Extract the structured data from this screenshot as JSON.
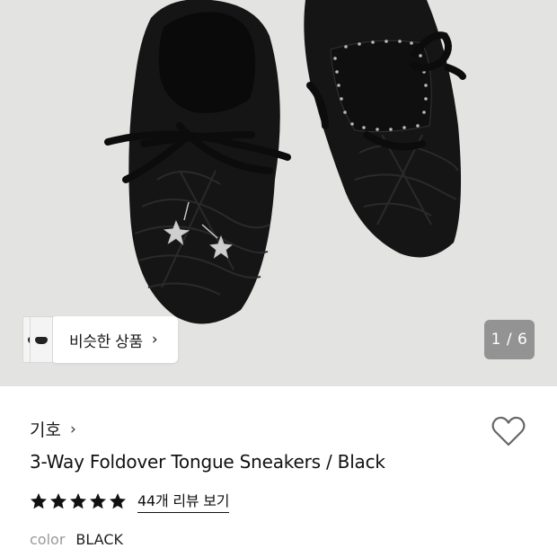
{
  "gallery": {
    "counter": "1 / 6",
    "similar_products_label": "비슷한 상품",
    "similar_chevron": "›"
  },
  "product": {
    "brand": "기호",
    "brand_chevron": "›",
    "title": "3-Way Foldover Tongue Sneakers / Black",
    "rating_stars": 5,
    "review_link": "44개 리뷰 보기",
    "color_label": "color",
    "color_value": "BLACK"
  },
  "colors": {
    "background": "#e3e3e1",
    "shoe": "#151515",
    "text": "#111111",
    "muted": "#999999"
  }
}
